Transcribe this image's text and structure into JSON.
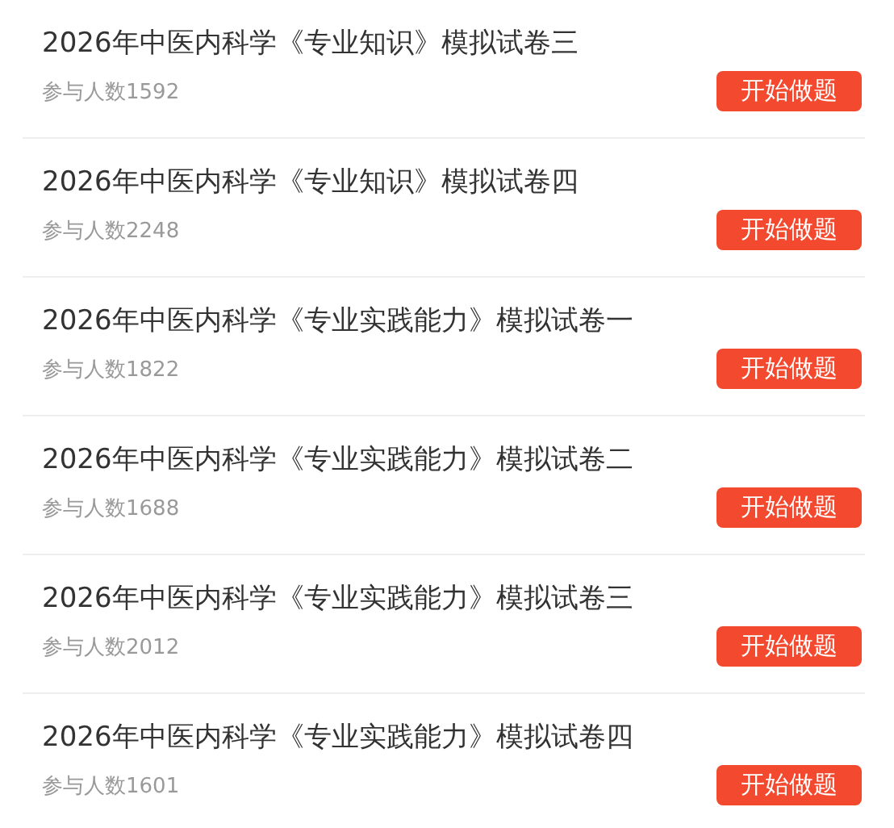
{
  "papers": [
    {
      "title": "2026年中医内科学《专业知识》模拟试卷三",
      "participants": "参与人数1592",
      "button": "开始做题"
    },
    {
      "title": "2026年中医内科学《专业知识》模拟试卷四",
      "participants": "参与人数2248",
      "button": "开始做题"
    },
    {
      "title": "2026年中医内科学《专业实践能力》模拟试卷一",
      "participants": "参与人数1822",
      "button": "开始做题"
    },
    {
      "title": "2026年中医内科学《专业实践能力》模拟试卷二",
      "participants": "参与人数1688",
      "button": "开始做题"
    },
    {
      "title": "2026年中医内科学《专业实践能力》模拟试卷三",
      "participants": "参与人数2012",
      "button": "开始做题"
    },
    {
      "title": "2026年中医内科学《专业实践能力》模拟试卷四",
      "participants": "参与人数1601",
      "button": "开始做题"
    }
  ]
}
